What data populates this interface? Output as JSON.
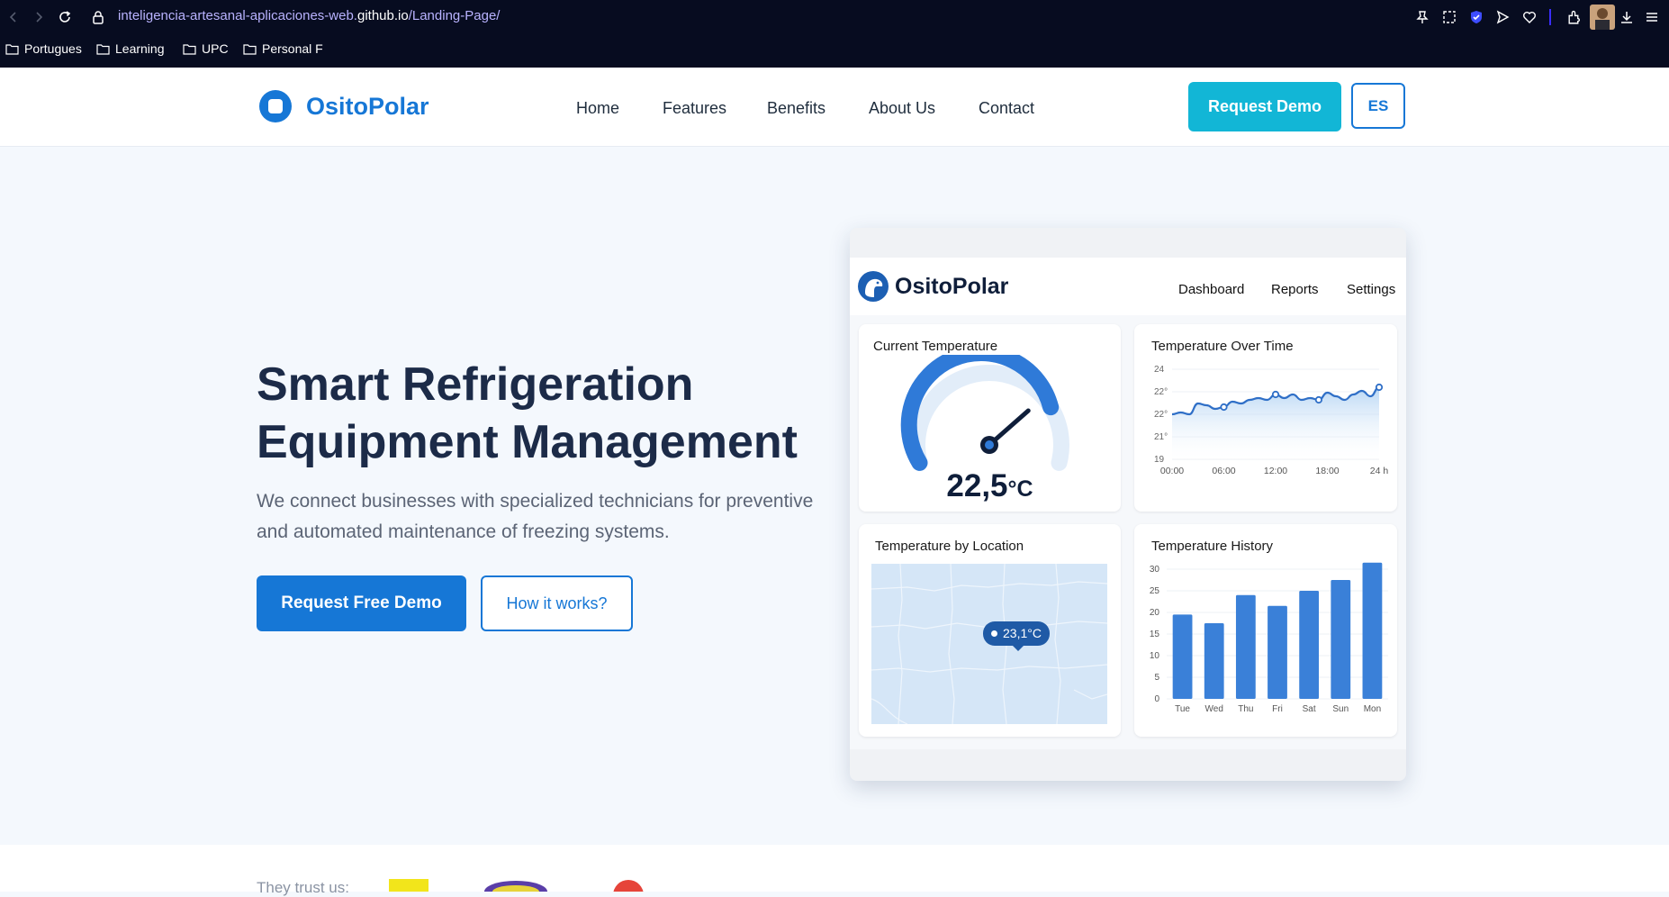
{
  "browser": {
    "url_path_prefix": "inteligencia-artesanal-aplicaciones-web.",
    "url_host": "github.io",
    "url_path": "/Landing-Page/",
    "bookmarks": [
      "Portugues",
      "Learning",
      "UPC",
      "Personal F"
    ]
  },
  "site": {
    "brand": "OsitoPolar",
    "nav": [
      "Home",
      "Features",
      "Benefits",
      "About Us",
      "Contact"
    ],
    "request_demo": "Request Demo",
    "lang": "ES"
  },
  "hero": {
    "title_line1": "Smart Refrigeration",
    "title_line2": "Equipment Management",
    "subtitle_line1": "We connect businesses with specialized technicians for preventive",
    "subtitle_line2": "and automated maintenance of freezing systems.",
    "primary_cta": "Request Free Demo",
    "secondary_cta": "How it works?"
  },
  "dashboard": {
    "brand": "OsitoPolar",
    "nav": [
      "Dashboard",
      "Reports",
      "Settings"
    ],
    "current_temp": {
      "title": "Current Temperature",
      "value": "22,5",
      "unit": "°C",
      "level": 0.78
    },
    "over_time": {
      "title": "Temperature Over Time",
      "y_ticks": [
        "24",
        "22°",
        "22°",
        "21°",
        "19"
      ],
      "x_ticks": [
        "00:00",
        "06:00",
        "12:00",
        "18:00",
        "24 h"
      ]
    },
    "location": {
      "title": "Temperature by Location",
      "marker": "23,1°C"
    },
    "history": {
      "title": "Temperature History",
      "y_ticks": [
        "30",
        "25",
        "20",
        "15",
        "10",
        "5",
        "0"
      ]
    }
  },
  "chart_data": [
    {
      "type": "line",
      "title": "Temperature Over Time",
      "x": [
        "00:00",
        "01:00",
        "02:00",
        "03:00",
        "04:00",
        "05:00",
        "06:00",
        "07:00",
        "08:00",
        "09:00",
        "10:00",
        "11:00",
        "12:00",
        "13:00",
        "14:00",
        "15:00",
        "16:00",
        "17:00",
        "18:00",
        "19:00",
        "20:00",
        "21:00",
        "22:00",
        "23:00",
        "24:00"
      ],
      "values": [
        21.5,
        21.6,
        21.5,
        22.1,
        22.0,
        21.8,
        21.9,
        22.2,
        22.1,
        22.3,
        22.4,
        22.3,
        22.6,
        22.4,
        22.6,
        22.3,
        22.4,
        22.3,
        22.7,
        22.5,
        22.3,
        22.6,
        22.8,
        22.5,
        23.0
      ],
      "ylim": [
        19,
        24
      ],
      "grid": true
    },
    {
      "type": "bar",
      "title": "Temperature History",
      "categories": [
        "Tue",
        "Wed",
        "Thu",
        "Fri",
        "Sat",
        "Sun",
        "Mon"
      ],
      "values": [
        19.5,
        17.5,
        24,
        21.5,
        25,
        27.5,
        31.5
      ],
      "ylim": [
        0,
        30
      ],
      "grid": true
    }
  ],
  "trust": {
    "label": "They trust us:"
  },
  "colors": {
    "brand": "#1677d6",
    "cta": "#12b6d6",
    "heading": "#1c2b48",
    "chart_blue": "#3a80d8"
  }
}
